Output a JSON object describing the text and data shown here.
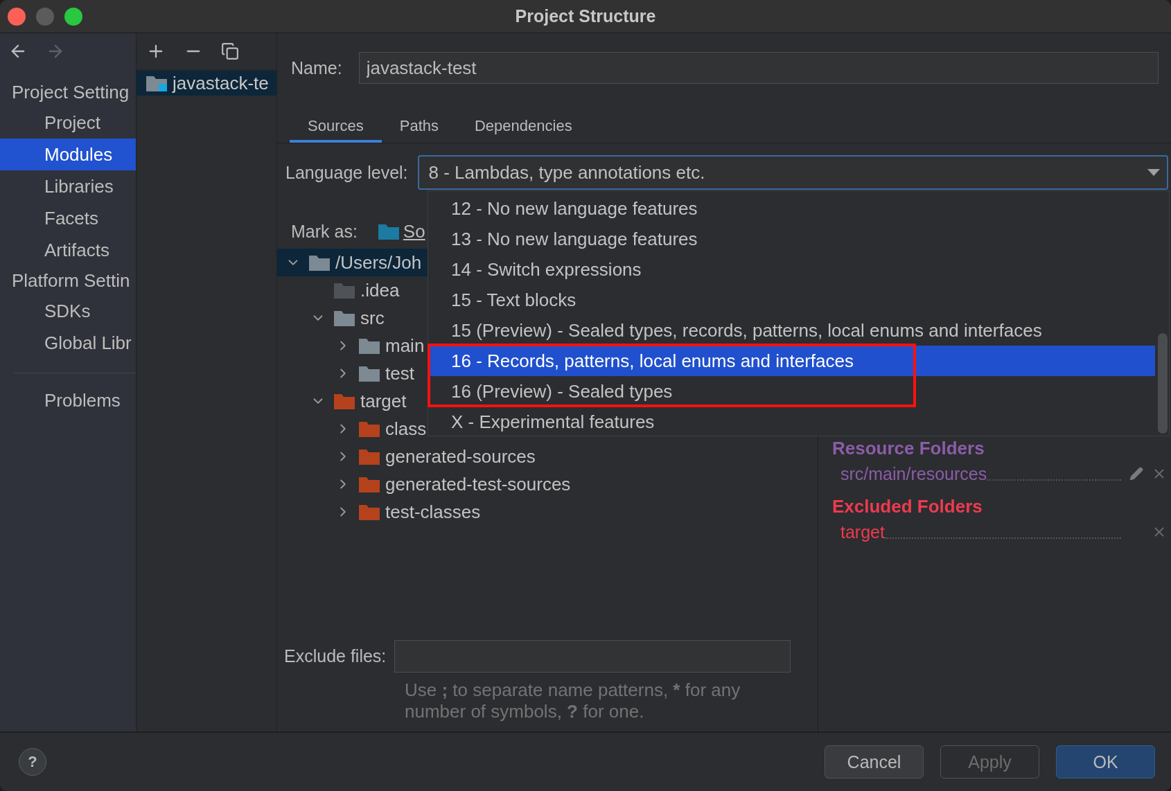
{
  "window": {
    "title": "Project Structure"
  },
  "sidebar": {
    "sections": [
      {
        "title": "Project Setting",
        "items": [
          {
            "label": "Project",
            "selected": false
          },
          {
            "label": "Modules",
            "selected": true
          },
          {
            "label": "Libraries",
            "selected": false
          },
          {
            "label": "Facets",
            "selected": false
          },
          {
            "label": "Artifacts",
            "selected": false
          }
        ]
      },
      {
        "title": "Platform Settin",
        "items": [
          {
            "label": "SDKs",
            "selected": false
          },
          {
            "label": "Global Libr",
            "selected": false
          }
        ]
      },
      {
        "items": [
          {
            "label": "Problems",
            "selected": false
          }
        ]
      }
    ]
  },
  "modules": {
    "items": [
      {
        "label": "javastack-te",
        "selected": true
      }
    ]
  },
  "name_field": {
    "label": "Name:",
    "value": "javastack-test"
  },
  "tabs": [
    {
      "label": "Sources",
      "selected": true
    },
    {
      "label": "Paths",
      "selected": false
    },
    {
      "label": "Dependencies",
      "selected": false
    }
  ],
  "language_level": {
    "label": "Language level:",
    "value": "8 - Lambdas, type annotations etc.",
    "options": [
      {
        "label": "12 - No new language features",
        "selected": false
      },
      {
        "label": "13 - No new language features",
        "selected": false
      },
      {
        "label": "14 - Switch expressions",
        "selected": false
      },
      {
        "label": "15 - Text blocks",
        "selected": false
      },
      {
        "label": "15 (Preview) - Sealed types, records, patterns, local enums and interfaces",
        "selected": false
      },
      {
        "label": "16 - Records, patterns, local enums and interfaces",
        "selected": true
      },
      {
        "label": "16 (Preview) - Sealed types",
        "selected": false
      },
      {
        "label": "X - Experimental features",
        "selected": false
      }
    ]
  },
  "mark_as": {
    "label": "Mark as:",
    "link": "So"
  },
  "tree": [
    {
      "label": "/Users/Joh",
      "kind": "folder",
      "expandable": true,
      "expanded": true,
      "selected": true,
      "children": [
        {
          "label": ".idea",
          "kind": "idea",
          "expandable": false,
          "expanded": false,
          "selected": false
        },
        {
          "label": "src",
          "kind": "folder",
          "expandable": true,
          "expanded": true,
          "selected": false,
          "children": [
            {
              "label": "main",
              "kind": "folder",
              "expandable": true,
              "expanded": false,
              "selected": false
            },
            {
              "label": "test",
              "kind": "folder",
              "expandable": true,
              "expanded": false,
              "selected": false
            }
          ]
        },
        {
          "label": "target",
          "kind": "excluded",
          "expandable": true,
          "expanded": true,
          "selected": false,
          "children": [
            {
              "label": "class",
              "kind": "excluded",
              "expandable": true,
              "expanded": false,
              "selected": false
            },
            {
              "label": "generated-sources",
              "kind": "excluded",
              "expandable": true,
              "expanded": false,
              "selected": false
            },
            {
              "label": "generated-test-sources",
              "kind": "excluded",
              "expandable": true,
              "expanded": false,
              "selected": false
            },
            {
              "label": "test-classes",
              "kind": "excluded",
              "expandable": true,
              "expanded": false,
              "selected": false
            }
          ]
        }
      ]
    }
  ],
  "folder_groups": [
    {
      "title": "Resource Folders",
      "kind": "resource",
      "entries": [
        {
          "path": "src/main/resources",
          "editable": true
        }
      ]
    },
    {
      "title": "Excluded Folders",
      "kind": "excluded",
      "entries": [
        {
          "path": "target",
          "editable": false
        }
      ]
    }
  ],
  "exclude_files": {
    "label": "Exclude files:",
    "hint": [
      {
        "text": "Use ",
        "bold": false
      },
      {
        "text": ";",
        "bold": true
      },
      {
        "text": " to separate name patterns, ",
        "bold": false
      },
      {
        "text": "*",
        "bold": true
      },
      {
        "text": " for any number of symbols, ",
        "bold": false
      },
      {
        "text": "?",
        "bold": true
      },
      {
        "text": " for one.",
        "bold": false
      }
    ]
  },
  "help": "?",
  "buttons": [
    {
      "label": "Cancel",
      "kind": "normal"
    },
    {
      "label": "Apply",
      "kind": "disabled"
    },
    {
      "label": "OK",
      "kind": "default"
    }
  ]
}
